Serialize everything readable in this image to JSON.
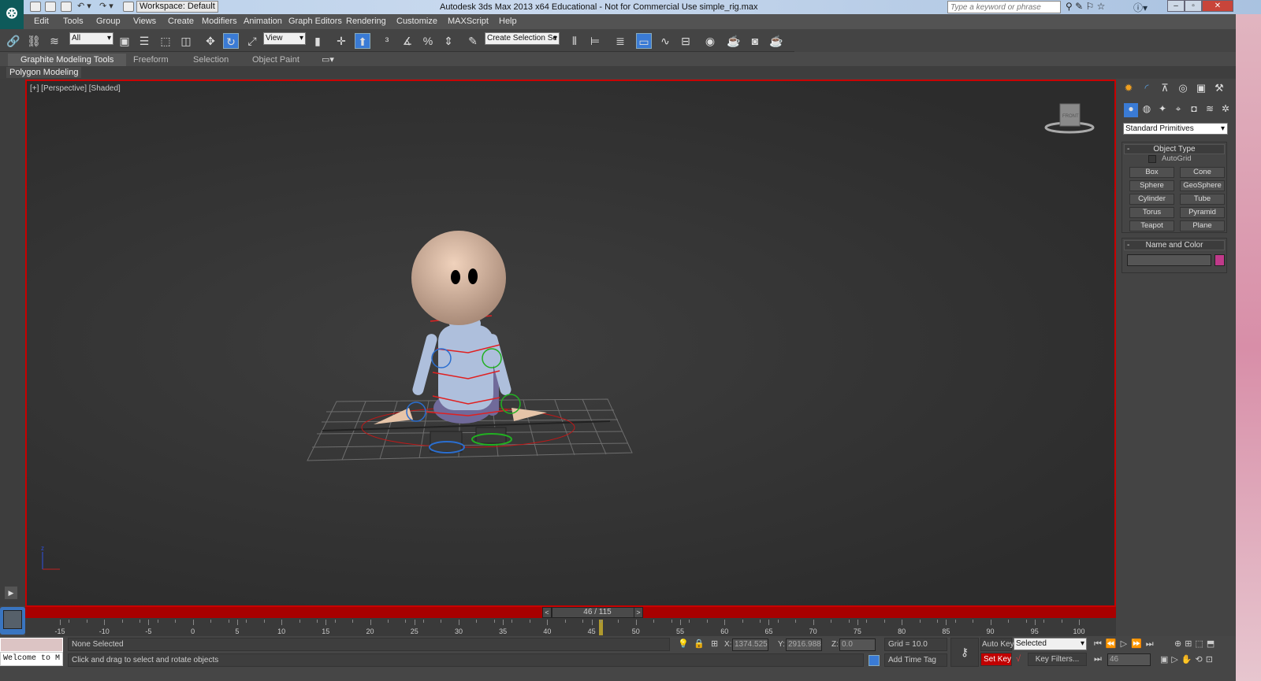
{
  "titlebar": {
    "workspace": "Workspace: Default",
    "title": "Autodesk 3ds Max  2013 x64   Educational - Not for Commercial Use    simple_rig.max",
    "search_placeholder": "Type a keyword or phrase"
  },
  "menu": [
    "Edit",
    "Tools",
    "Group",
    "Views",
    "Create",
    "Modifiers",
    "Animation",
    "Graph Editors",
    "Rendering",
    "Customize",
    "MAXScript",
    "Help"
  ],
  "toolbar": {
    "selection_filter": "All",
    "reference_coord": "View",
    "named_selection": "Create Selection Se"
  },
  "ribbon": {
    "tabs": [
      "Graphite Modeling Tools",
      "Freeform",
      "Selection",
      "Object Paint"
    ],
    "panel": "Polygon Modeling"
  },
  "viewport": {
    "label": "[+] [Perspective] [Shaded]",
    "viewcube_face": "FRONT"
  },
  "command_panel": {
    "category": "Standard Primitives",
    "object_type_title": "Object Type",
    "autogrid": "AutoGrid",
    "buttons": [
      "Box",
      "Cone",
      "Sphere",
      "GeoSphere",
      "Cylinder",
      "Tube",
      "Torus",
      "Pyramid",
      "Teapot",
      "Plane"
    ],
    "name_color_title": "Name and Color",
    "object_color": "#c03a8a"
  },
  "timeline": {
    "frame_display": "46 / 115",
    "current_frame": 46,
    "start": -15,
    "end": 100,
    "labels": [
      "-15",
      "-10",
      "-5",
      "0",
      "5",
      "10",
      "15",
      "20",
      "25",
      "30",
      "35",
      "40",
      "45",
      "50",
      "55",
      "60",
      "65",
      "70",
      "75",
      "80",
      "85",
      "90",
      "95",
      "100"
    ]
  },
  "status": {
    "listener": "Welcome to M",
    "selection": "None Selected",
    "prompt": "Click and drag to select and rotate objects",
    "x": "1374.525",
    "y": "2916.988",
    "z": "0.0",
    "grid": "Grid = 10.0",
    "add_time_tag": "Add Time Tag",
    "auto_key": "Auto Key",
    "set_key": "Set Key",
    "key_mode": "Selected",
    "key_filters": "Key Filters...",
    "frame": "46"
  }
}
